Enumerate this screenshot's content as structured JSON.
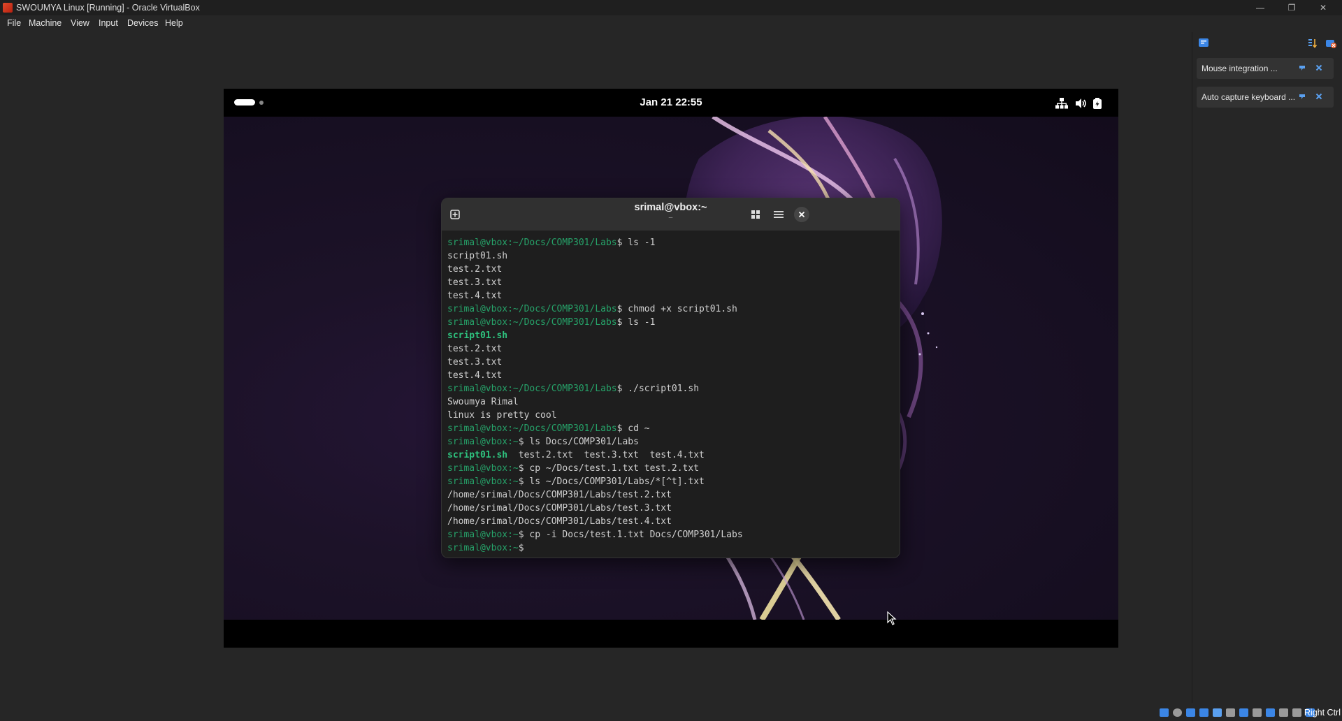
{
  "window": {
    "title": "SWOUMYA Linux [Running] - Oracle VirtualBox",
    "controls": [
      "minimize",
      "restore",
      "close"
    ]
  },
  "menu": [
    "File",
    "Machine",
    "View",
    "Input",
    "Devices",
    "Help"
  ],
  "gnome_bar": {
    "clock": "Jan 21  22:55",
    "tray_icons": [
      "network-icon",
      "volume-icon",
      "battery-icon"
    ]
  },
  "terminal": {
    "title": "srimal@vbox:~",
    "subtitle": "–",
    "lines": [
      [
        {
          "t": "srimal@vbox:~/Docs/COMP301/Labs",
          "c": "p"
        },
        {
          "t": "$ ls -1"
        }
      ],
      [
        {
          "t": "script01.sh"
        }
      ],
      [
        {
          "t": "test.2.txt"
        }
      ],
      [
        {
          "t": "test.3.txt"
        }
      ],
      [
        {
          "t": "test.4.txt"
        }
      ],
      [
        {
          "t": "srimal@vbox:~/Docs/COMP301/Labs",
          "c": "p"
        },
        {
          "t": "$ chmod +x script01.sh"
        }
      ],
      [
        {
          "t": "srimal@vbox:~/Docs/COMP301/Labs",
          "c": "p"
        },
        {
          "t": "$ ls -1"
        }
      ],
      [
        {
          "t": "script01.sh",
          "c": "x"
        }
      ],
      [
        {
          "t": "test.2.txt"
        }
      ],
      [
        {
          "t": "test.3.txt"
        }
      ],
      [
        {
          "t": "test.4.txt"
        }
      ],
      [
        {
          "t": "srimal@vbox:~/Docs/COMP301/Labs",
          "c": "p"
        },
        {
          "t": "$ ./script01.sh"
        }
      ],
      [
        {
          "t": "Swoumya Rimal"
        }
      ],
      [
        {
          "t": "linux is pretty cool"
        }
      ],
      [
        {
          "t": "srimal@vbox:~/Docs/COMP301/Labs",
          "c": "p"
        },
        {
          "t": "$ cd ~"
        }
      ],
      [
        {
          "t": "srimal@vbox:~",
          "c": "p"
        },
        {
          "t": "$ ls Docs/COMP301/Labs"
        }
      ],
      [
        {
          "t": "script01.sh",
          "c": "x"
        },
        {
          "t": "  test.2.txt  test.3.txt  test.4.txt"
        }
      ],
      [
        {
          "t": "srimal@vbox:~",
          "c": "p"
        },
        {
          "t": "$ cp ~/Docs/test.1.txt test.2.txt"
        }
      ],
      [
        {
          "t": "srimal@vbox:~",
          "c": "p"
        },
        {
          "t": "$ ls ~/Docs/COMP301/Labs/*[^t].txt"
        }
      ],
      [
        {
          "t": "/home/srimal/Docs/COMP301/Labs/test.2.txt"
        }
      ],
      [
        {
          "t": "/home/srimal/Docs/COMP301/Labs/test.3.txt"
        }
      ],
      [
        {
          "t": "/home/srimal/Docs/COMP301/Labs/test.4.txt"
        }
      ],
      [
        {
          "t": "srimal@vbox:~",
          "c": "p"
        },
        {
          "t": "$ cp -i Docs/test.1.txt Docs/COMP301/Labs"
        }
      ],
      [
        {
          "t": "srimal@vbox:~",
          "c": "p"
        },
        {
          "t": "$ "
        }
      ]
    ]
  },
  "notifications": [
    {
      "text": "Mouse integration ..."
    },
    {
      "text": "Auto capture keyboard ..."
    }
  ],
  "statusbar": {
    "host_key": "Right Ctrl",
    "icons": [
      "hard-disk-icon",
      "optical-drive-icon",
      "audio-icon",
      "network-status-icon",
      "usb-icon",
      "shared-folders-icon",
      "display-icon",
      "video-capture-icon",
      "recording-icon",
      "cpu-icon",
      "mouse-capture-icon",
      "keyboard-capture-icon"
    ]
  },
  "colors": {
    "prompt_green": "#26a269",
    "exec_green": "#2ec27e",
    "terminal_bg": "#1e1e1e",
    "header_bg": "#303030"
  }
}
